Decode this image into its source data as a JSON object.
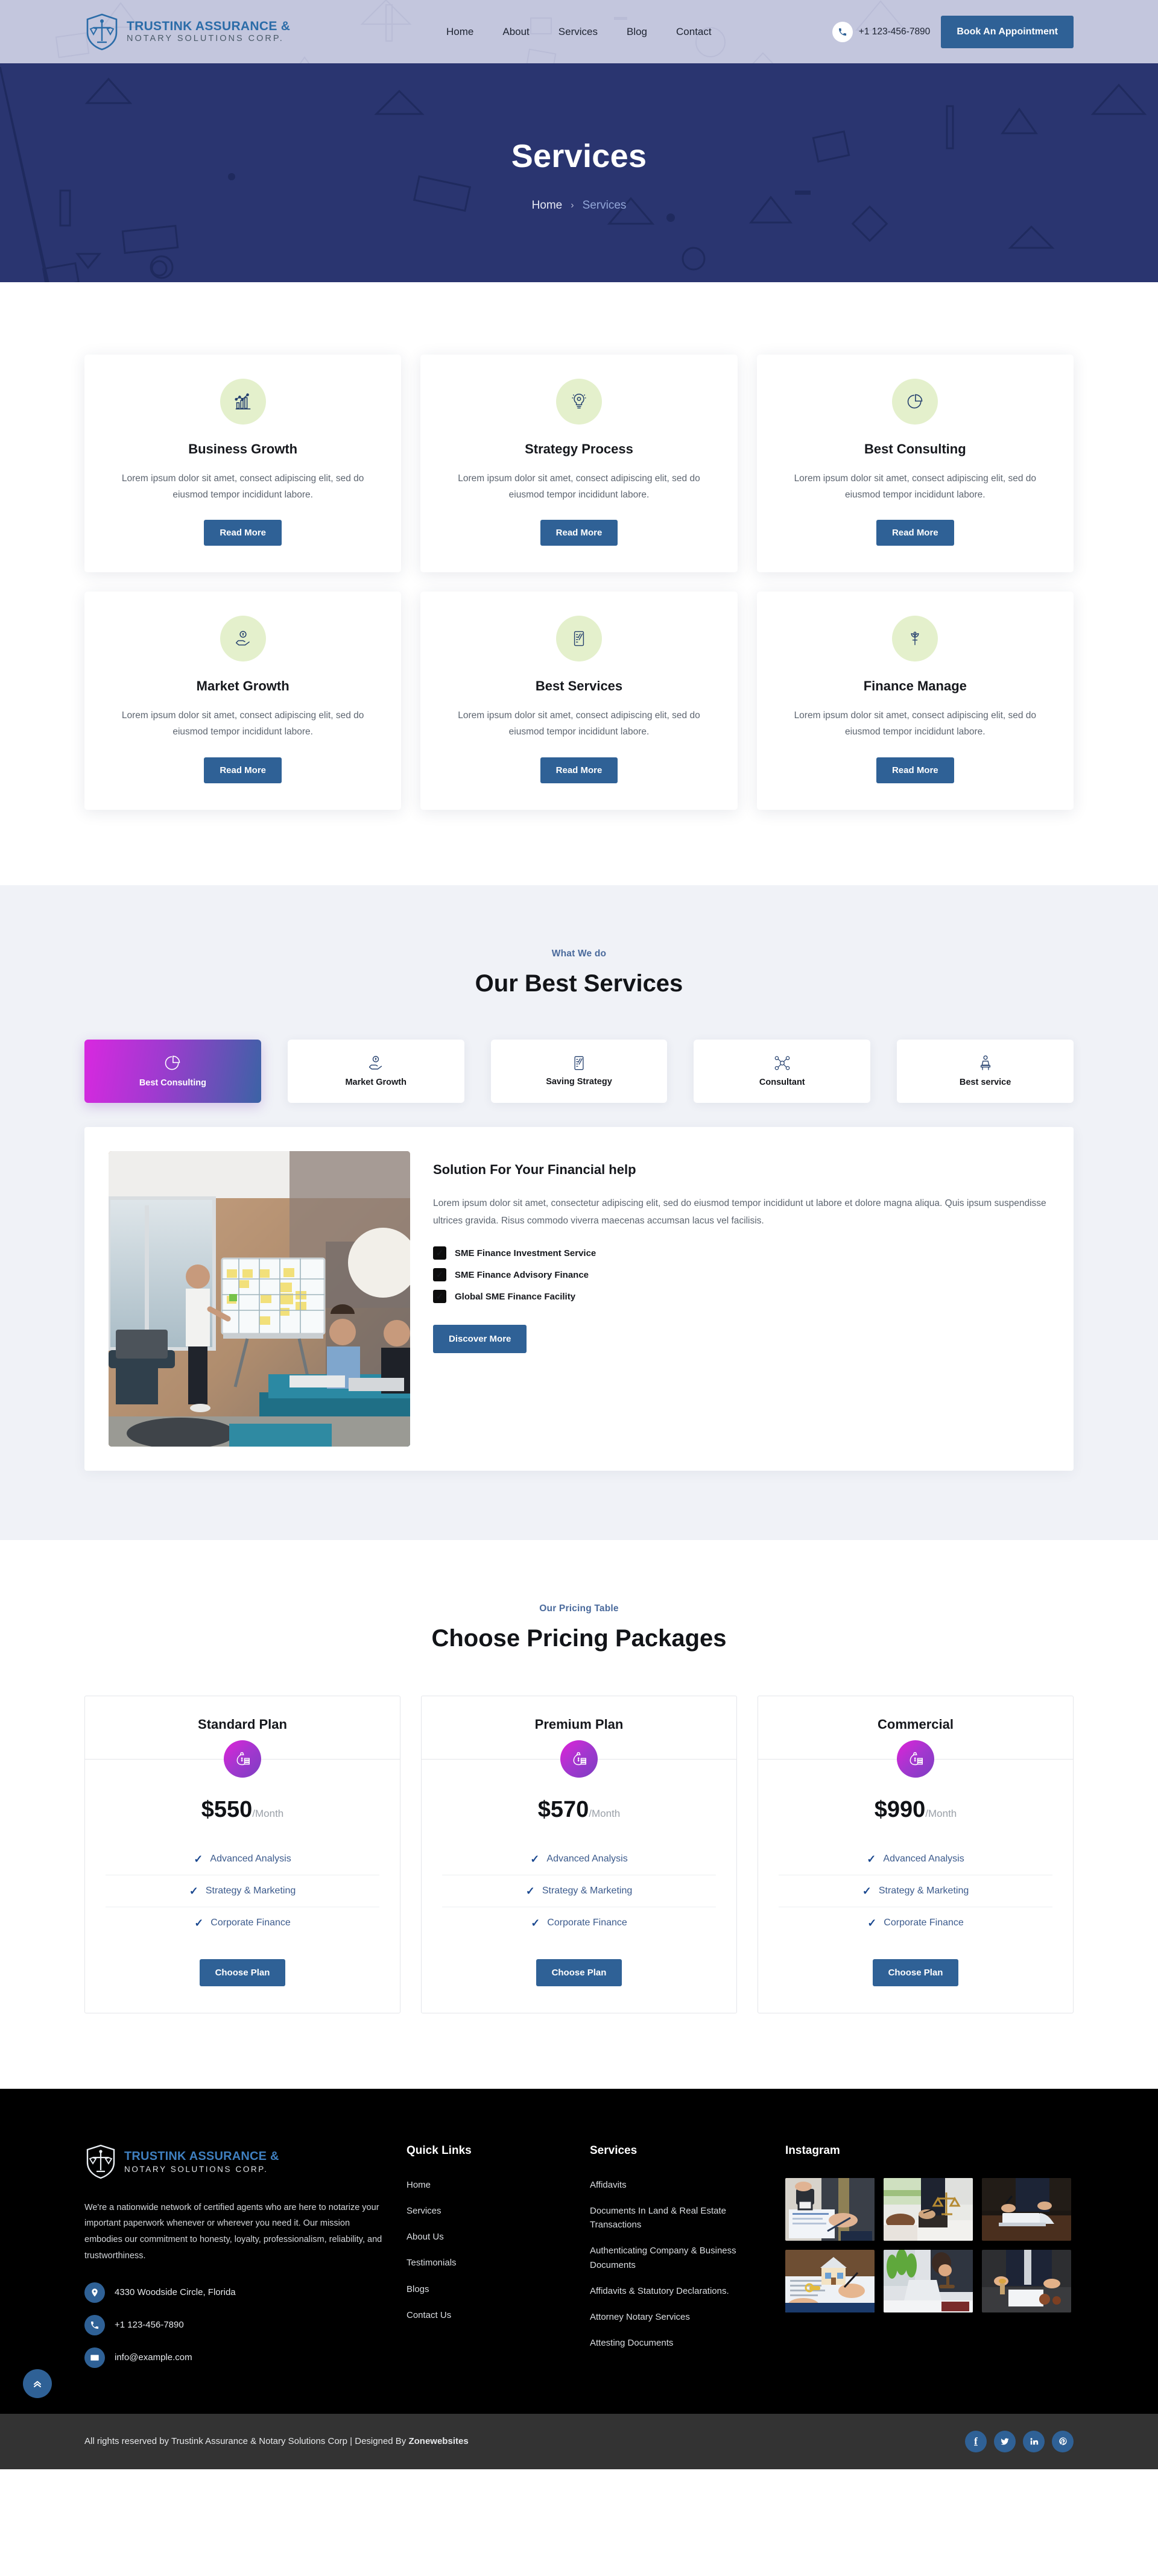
{
  "header": {
    "brand": {
      "line1": "TRUSTINK ASSURANCE &",
      "line2": "NOTARY SOLUTIONS CORP."
    },
    "nav": [
      {
        "label": "Home"
      },
      {
        "label": "About"
      },
      {
        "label": "Services"
      },
      {
        "label": "Blog"
      },
      {
        "label": "Contact"
      }
    ],
    "phone": "+1 123-456-7890",
    "cta": "Book An Appointment"
  },
  "hero": {
    "title": "Services",
    "breadcrumb": {
      "home": "Home",
      "separator": "›",
      "current": "Services"
    }
  },
  "services": {
    "cards": [
      {
        "title": "Business Growth",
        "icon": "bar-chart-growth-icon",
        "text": "Lorem ipsum dolor sit amet, consect adipiscing elit, sed do eiusmod tempor incididunt labore.",
        "button": "Read More"
      },
      {
        "title": "Strategy Process",
        "icon": "lightbulb-brain-icon",
        "text": "Lorem ipsum dolor sit amet, consect adipiscing elit, sed do eiusmod tempor incididunt labore.",
        "button": "Read More"
      },
      {
        "title": "Best Consulting",
        "icon": "pie-chart-icon",
        "text": "Lorem ipsum dolor sit amet, consect adipiscing elit, sed do eiusmod tempor incididunt labore.",
        "button": "Read More"
      },
      {
        "title": "Market Growth",
        "icon": "hand-coin-icon",
        "text": "Lorem ipsum dolor sit amet, consect adipiscing elit, sed do eiusmod tempor incididunt labore.",
        "button": "Read More"
      },
      {
        "title": "Best Services",
        "icon": "checklist-pencil-icon",
        "text": "Lorem ipsum dolor sit amet, consect adipiscing elit, sed do eiusmod tempor incididunt labore.",
        "button": "Read More"
      },
      {
        "title": "Finance Manage",
        "icon": "money-plant-icon",
        "text": "Lorem ipsum dolor sit amet, consect adipiscing elit, sed do eiusmod tempor incididunt labore.",
        "button": "Read More"
      }
    ]
  },
  "best": {
    "eyebrow": "What We do",
    "title": "Our Best Services",
    "tabs": [
      {
        "label": "Best Consulting",
        "icon": "pie-chart-icon",
        "active": true
      },
      {
        "label": "Market Growth",
        "icon": "hand-coin-icon",
        "active": false
      },
      {
        "label": "Saving Strategy",
        "icon": "checklist-pencil-icon",
        "active": false
      },
      {
        "label": "Consultant",
        "icon": "network-people-icon",
        "active": false
      },
      {
        "label": "Best service",
        "icon": "presenter-icon",
        "active": false
      }
    ],
    "panel": {
      "image_alt": "team-meeting-whiteboard-photo",
      "title": "Solution For Your Financial help",
      "paragraph": "Lorem ipsum dolor sit amet, consectetur adipiscing elit, sed do eiusmod tempor incididunt ut labore et dolore magna aliqua. Quis ipsum suspendisse ultrices gravida. Risus commodo viverra maecenas accumsan lacus vel facilisis.",
      "checks": [
        "SME Finance Investment Service",
        "SME Finance Advisory Finance",
        "Global SME Finance Facility"
      ],
      "button": "Discover More"
    }
  },
  "pricing": {
    "eyebrow": "Our Pricing Table",
    "title": "Choose Pricing Packages",
    "plans": [
      {
        "name": "Standard Plan",
        "icon": "money-bag-icon",
        "amount": "$550",
        "period": "/Month",
        "features": [
          "Advanced Analysis",
          "Strategy & Marketing",
          "Corporate Finance"
        ],
        "button": "Choose Plan"
      },
      {
        "name": "Premium Plan",
        "icon": "money-bag-icon",
        "amount": "$570",
        "period": "/Month",
        "features": [
          "Advanced Analysis",
          "Strategy & Marketing",
          "Corporate Finance"
        ],
        "button": "Choose Plan"
      },
      {
        "name": "Commercial",
        "icon": "money-bag-icon",
        "amount": "$990",
        "period": "/Month",
        "features": [
          "Advanced Analysis",
          "Strategy & Marketing",
          "Corporate Finance"
        ],
        "button": "Choose Plan"
      }
    ]
  },
  "footer": {
    "brand": {
      "line1": "TRUSTINK ASSURANCE &",
      "line2": "NOTARY SOLUTIONS CORP."
    },
    "about": "We're a nationwide network of certified agents who are here to notarize your important paperwork whenever or wherever you need it. Our mission embodies our commitment to honesty, loyalty, professionalism, reliability, and trustworthiness.",
    "contact": {
      "address": "4330 Woodside Circle, Florida",
      "phone": "+1 123-456-7890",
      "email": "info@example.com"
    },
    "quick_links": {
      "title": "Quick Links",
      "items": [
        "Home",
        "Services",
        "About Us",
        "Testimonials",
        "Blogs",
        "Contact Us"
      ]
    },
    "services": {
      "title": "Services",
      "items": [
        "Affidavits",
        "Documents In Land & Real Estate Transactions",
        "Authenticating Company & Business Documents",
        "Affidavits & Statutory Declarations.",
        "Attorney Notary Services",
        "Attesting Documents"
      ]
    },
    "instagram": {
      "title": "Instagram",
      "thumbs": [
        "notary-stamping-document-photo",
        "lawyers-with-scales-of-justice-photo",
        "man-signing-stack-of-papers-photo",
        "house-model-key-contract-photo",
        "woman-with-laptop-gavel-photo",
        "wax-seal-notary-photo"
      ]
    },
    "to_top": "scroll-to-top"
  },
  "bottombar": {
    "copyright_prefix": "All rights reserved by Trustink Assurance & Notary Solutions Corp | Designed By ",
    "designer": "Zonewebsites",
    "socials": [
      {
        "name": "facebook",
        "glyph": "f"
      },
      {
        "name": "twitter",
        "glyph": "ᵗ"
      },
      {
        "name": "linkedin",
        "glyph": "in"
      },
      {
        "name": "pinterest",
        "glyph": "р"
      }
    ]
  },
  "colors": {
    "header_bg": "#c3c6dd",
    "hero_bg": "#2a3570",
    "primary_blue": "#2f6196",
    "section_grey": "#f0f2f7",
    "icon_green": "#e4f0cc",
    "gradient_start": "#d928e0",
    "gradient_end": "#3b63a5",
    "footer_bg": "#000000",
    "bottombar_bg": "#333333"
  }
}
